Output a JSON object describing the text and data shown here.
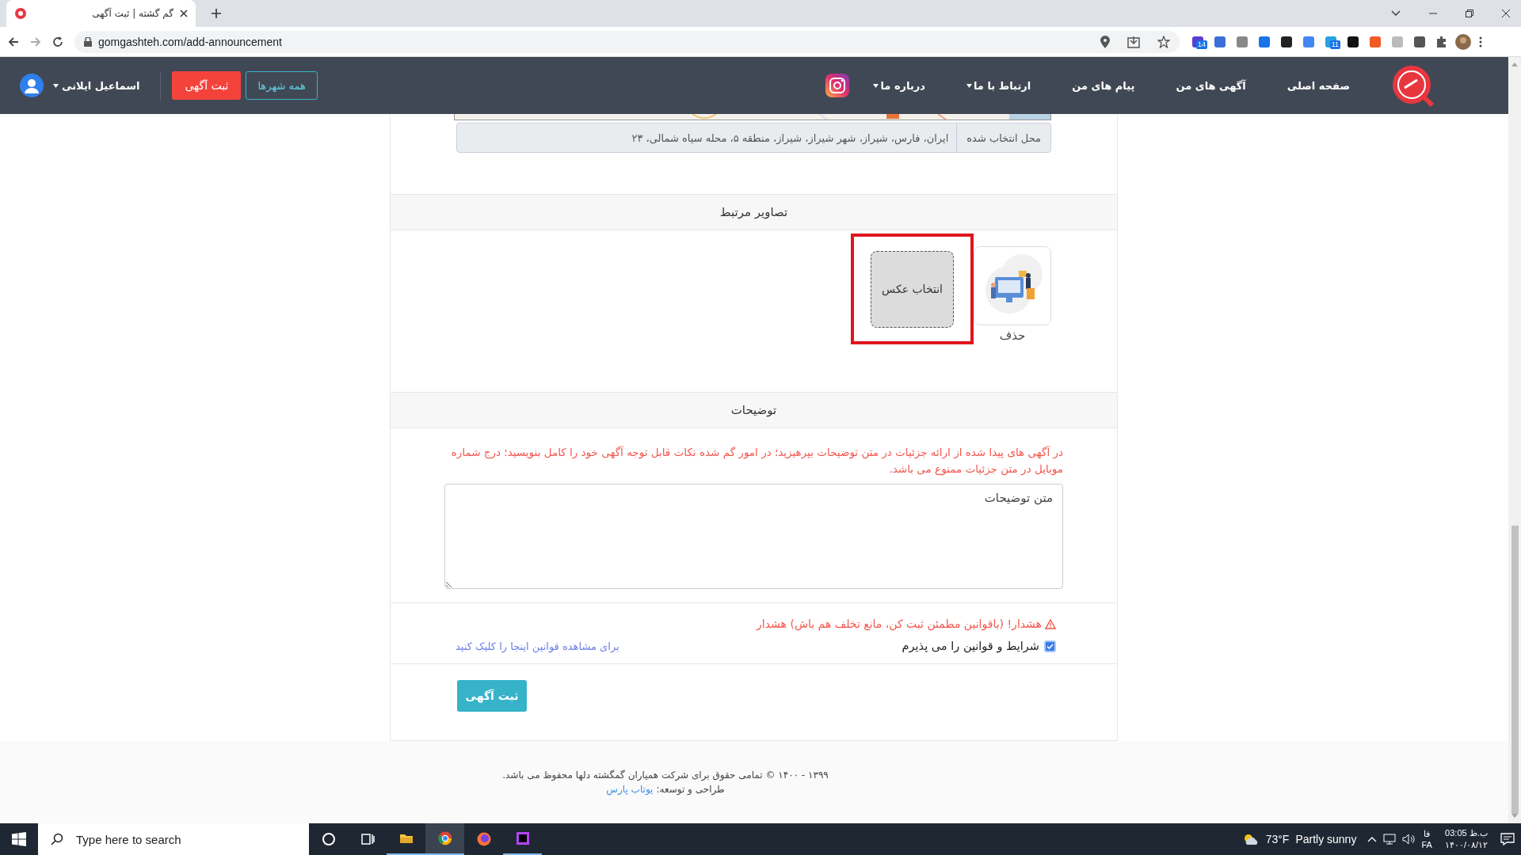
{
  "browser": {
    "tab_title": "گم گشته | ثبت آگهی",
    "url": "gomgashteh.com/add-announcement",
    "left_extension_badge": "14",
    "right_extension_badge": "11"
  },
  "nav": {
    "links": [
      {
        "label": "صفحه اصلی",
        "kind": "link"
      },
      {
        "label": "آگهی های من",
        "kind": "link"
      },
      {
        "label": "پیام های من",
        "kind": "link"
      },
      {
        "label": "ارتباط با ما",
        "kind": "dropdown"
      },
      {
        "label": "درباره ما",
        "kind": "dropdown"
      }
    ],
    "all_cities_button": "همه شهرها",
    "post_button": "ثبت آگهی",
    "user_name": "اسماعیل ایلانی"
  },
  "location": {
    "label": "محل انتخاب شده",
    "value": "ایران، فارس، شیراز، شهر شیراز، شیراز، منطقه ۵، محله سیاه شمالی، ۲۳"
  },
  "images": {
    "heading": "تصاویر مرتبط",
    "items": [
      {
        "kind": "picture",
        "delete_label": "حذف"
      }
    ],
    "select_button": "انتخاب عکس",
    "highlighted": true
  },
  "description": {
    "heading": "توضیحات",
    "notice": "در آگهی های پیدا شده از ارائه جزئیات در متن توضیحات بپرهیزید؛ در امور گم شده نکات قابل توجه آگهی خود را کامل بنویسید؛ درج شماره موبایل در متن جزئیات ممنوع می باشد.",
    "placeholder": "متن توضیحات"
  },
  "terms": {
    "warning": "هشدار! (باقوانین مطمئن ثبت کن، مانع تخلف هم باش) هشدار",
    "accept_label": "شرایط و قوانین را می پذیرم",
    "checked": true,
    "rules_link": "برای مشاهده قوانین اینجا را کلیک کنید"
  },
  "submit_button": "ثبت آگهی",
  "footer": {
    "copyright": "۱۳۹۹ - ۱۴۰۰ © تمامی حقوق برای شرکت همیاران گمگشته دلها محفوظ می باشد.",
    "credit_label": "طراحی و توسعه:",
    "credit_link": "یوتاب پارس"
  },
  "taskbar": {
    "search_placeholder": "Type here to search",
    "temperature": "73°F",
    "condition": "Partly sunny",
    "lang_short": "فا",
    "lang": "FA",
    "time": "03:05 ب.ظ",
    "date": "۱۴۰۰/۰۸/۱۲"
  }
}
